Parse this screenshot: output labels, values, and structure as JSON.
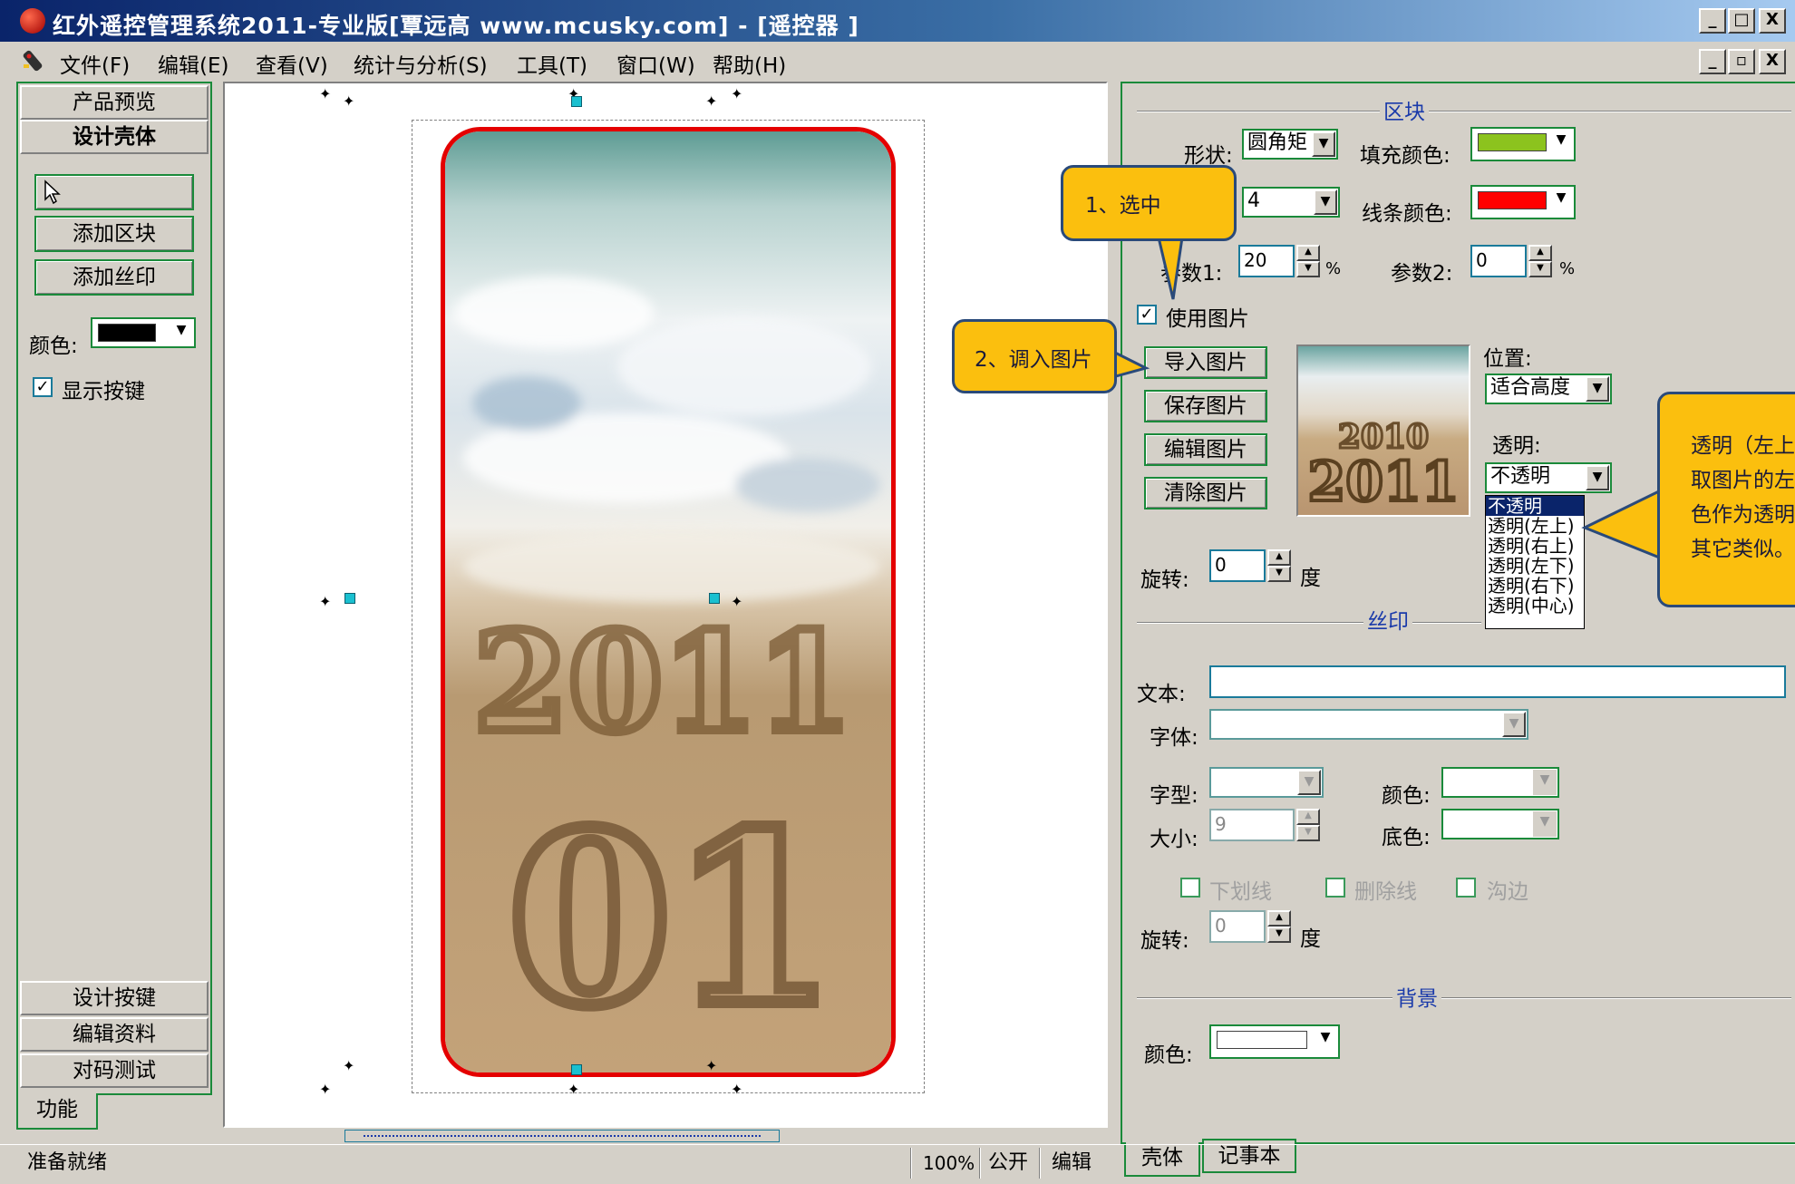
{
  "window": {
    "title": "红外遥控管理系统2011-专业版[覃远高 www.mcusky.com] - [遥控器 ]",
    "min_label": "_",
    "max_label": "□",
    "close_label": "X",
    "restore_label": "▫"
  },
  "menu": {
    "items": [
      "文件(F)",
      "编辑(E)",
      "查看(V)",
      "统计与分析(S)",
      "工具(T)",
      "窗口(W)",
      "帮助(H)"
    ]
  },
  "left_panel": {
    "cat_preview": "产品预览",
    "cat_design_shell": "设计壳体",
    "add_block": "添加区块",
    "add_silk": "添加丝印",
    "color_label": "颜色:",
    "color_value": "#000000",
    "show_keys_label": "显示按键",
    "show_keys_checked": "✓",
    "cat_design_keys": "设计按键",
    "cat_edit_data": "编辑资料",
    "cat_code_test": "对码测试",
    "tab_function": "功能"
  },
  "block_section": {
    "title": "区块",
    "shape_label": "形状:",
    "shape_value": "圆角矩",
    "fill_color_label": "填充颜色:",
    "fill_color": "#8cc31e",
    "line_width_value": "4",
    "line_color_label": "线条颜色:",
    "line_color": "#ff0000",
    "param1_label": "参数1:",
    "param1_value": "20",
    "param1_unit": "%",
    "param2_label": "参数2:",
    "param2_value": "0",
    "param2_unit": "%",
    "use_image_label": "使用图片",
    "use_image_checked": "✓",
    "import_image": "导入图片",
    "save_image": "保存图片",
    "edit_image": "编辑图片",
    "clear_image": "清除图片",
    "thumb_text_top": "2010",
    "thumb_text_bottom": "2011",
    "position_label": "位置:",
    "position_value": "适合高度",
    "transparent_label": "透明:",
    "transparent_value": "不透明",
    "transparent_options": [
      "不透明",
      "透明(左上)",
      "透明(右上)",
      "透明(左下)",
      "透明(右下)",
      "透明(中心)"
    ],
    "rotate_label": "旋转:",
    "rotate_value": "0",
    "rotate_unit": "度"
  },
  "silk_section": {
    "title": "丝印",
    "text_label": "文本:",
    "text_value": "",
    "font_label": "字体:",
    "font_value": "",
    "style_label": "字型:",
    "color_label": "颜色:",
    "size_label": "大小:",
    "size_value": "9",
    "bgcolor_label": "底色:",
    "underline_label": "下划线",
    "strikeout_label": "删除线",
    "outline_label": "沟边",
    "rotate_label": "旋转:",
    "rotate_value": "0",
    "rotate_unit": "度"
  },
  "background_section": {
    "title": "背景",
    "color_label": "颜色:",
    "color_value": "#ffffff"
  },
  "bottom_tabs": {
    "shell": "壳体",
    "notepad": "记事本"
  },
  "callouts": {
    "step1": "1、选中",
    "step2": "2、调入图片",
    "note_line1": "透明（左上",
    "note_line2": "取图片的左",
    "note_line3": "色作为透明",
    "note_line4": "其它类似。"
  },
  "canvas": {
    "sand_text_1": "2011",
    "sand_text_2": "01"
  },
  "statusbar": {
    "ready": "准备就绪",
    "zoom": "100%",
    "visibility": "公开",
    "mode": "编辑"
  }
}
